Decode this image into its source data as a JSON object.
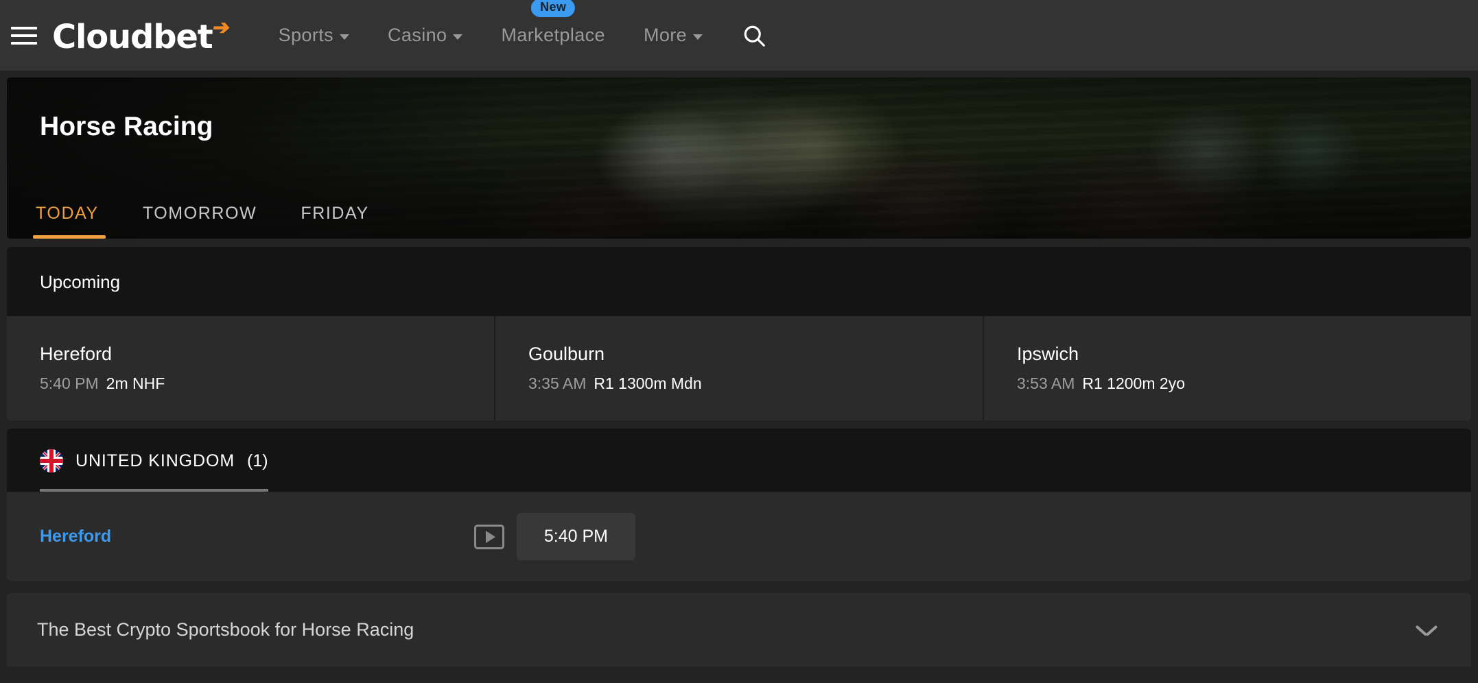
{
  "nav": {
    "menu_icon": "hamburger-menu-icon",
    "brand": "Cloudbet",
    "brand_bolt": "⚡",
    "items": [
      {
        "label": "Sports",
        "has_caret": true,
        "badge": ""
      },
      {
        "label": "Casino",
        "has_caret": true,
        "badge": ""
      },
      {
        "label": "Marketplace",
        "has_caret": false,
        "badge": "New"
      },
      {
        "label": "More",
        "has_caret": true,
        "badge": ""
      }
    ],
    "search_icon": "search-icon"
  },
  "hero": {
    "title": "Horse Racing",
    "tabs": [
      {
        "label": "TODAY",
        "active": true
      },
      {
        "label": "TOMORROW",
        "active": false
      },
      {
        "label": "FRIDAY",
        "active": false
      }
    ]
  },
  "upcoming": {
    "title": "Upcoming",
    "races": [
      {
        "venue": "Hereford",
        "time": "5:40 PM",
        "detail": "2m NHF"
      },
      {
        "venue": "Goulburn",
        "time": "3:35 AM",
        "detail": "R1 1300m Mdn"
      },
      {
        "venue": "Ipswich",
        "time": "3:53 AM",
        "detail": "R1 1200m 2yo"
      }
    ]
  },
  "country": {
    "flag": "united-kingdom-flag-icon",
    "name": "UNITED KINGDOM",
    "count": "(1)",
    "events": [
      {
        "name": "Hereford",
        "stream_icon": "stream-play-icon",
        "time": "5:40 PM"
      }
    ]
  },
  "seo": {
    "title": "The Best Crypto Sportsbook for Horse Racing",
    "expand_icon": "chevron-down-icon"
  },
  "colors": {
    "accent_orange": "#f0a040",
    "link_blue": "#3b9bf0",
    "badge_blue": "#3b9bf0",
    "bolt_orange": "#f08a24",
    "page_bg": "#232323",
    "topbar_bg": "#333333",
    "panel_bg": "#2b2b2b",
    "panel_head_bg": "#141414"
  }
}
